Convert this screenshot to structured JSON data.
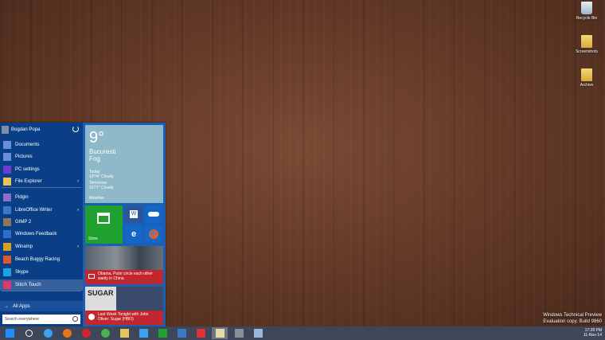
{
  "desktop": {
    "icons": [
      {
        "label": "Recycle Bin",
        "icon": "recycle-bin-icon"
      },
      {
        "label": "Screenshots",
        "icon": "folder-icon"
      },
      {
        "label": "Archive",
        "icon": "folder-icon"
      }
    ],
    "watermark": {
      "line1": "Windows Technical Preview",
      "line2": "Evaluation copy. Build 9860"
    }
  },
  "start_menu": {
    "user_name": "Bogdan Popa",
    "items": [
      {
        "label": "Documents",
        "icon": "documents-icon",
        "color": "#6b8fd6",
        "has_arrow": false
      },
      {
        "label": "Pictures",
        "icon": "pictures-icon",
        "color": "#6b8fd6",
        "has_arrow": false
      },
      {
        "label": "PC settings",
        "icon": "gear-icon",
        "color": "#6a3fd0",
        "has_arrow": false
      },
      {
        "label": "File Explorer",
        "icon": "folder-icon",
        "color": "#e8c25a",
        "has_arrow": true
      },
      {
        "label": "Pidgin",
        "icon": "pidgin-icon",
        "color": "#8a6fc6",
        "has_arrow": false
      },
      {
        "label": "LibreOffice Writer",
        "icon": "writer-icon",
        "color": "#3a78c8",
        "has_arrow": true
      },
      {
        "label": "GIMP 2",
        "icon": "gimp-icon",
        "color": "#8a7a5a",
        "has_arrow": false
      },
      {
        "label": "Windows Feedback",
        "icon": "feedback-icon",
        "color": "#2d6ecf",
        "has_arrow": false
      },
      {
        "label": "Winamp",
        "icon": "winamp-icon",
        "color": "#d4a020",
        "has_arrow": true
      },
      {
        "label": "Beach Buggy Racing",
        "icon": "game-icon",
        "color": "#d85a2a",
        "has_arrow": false
      },
      {
        "label": "Skype",
        "icon": "skype-icon",
        "color": "#1aa3e0",
        "has_arrow": false
      },
      {
        "label": "Stitch Touch",
        "icon": "heart-icon",
        "color": "#e0386a",
        "has_arrow": false
      }
    ],
    "all_apps": "All Apps",
    "search_placeholder": "Search everywhere",
    "tiles": {
      "weather": {
        "temp": "9°",
        "city": "Bucuresti",
        "condition": "Fog",
        "today": "Today",
        "today_fc": "10°/4° Cloudy",
        "tomorrow": "Tomorrow",
        "tomorrow_fc": "10°/7° Cloudy",
        "label": "Weather"
      },
      "store": {
        "label": "Store"
      },
      "news1": {
        "caption": "Obama, Putin circle each other warily in China"
      },
      "news2": {
        "banner": "SUGAR",
        "caption": "Last Week Tonight with John Oliver: Sugar (HBO)"
      }
    }
  },
  "taskbar": {
    "apps": [
      "start-icon",
      "search-icon",
      "ie-icon",
      "firefox-icon",
      "opera-icon",
      "chrome-icon",
      "explorer-icon",
      "twitter-icon",
      "store-icon",
      "game-icon",
      "plane-icon",
      "paint-icon",
      "mail-icon",
      "notepad-icon"
    ],
    "time": "17:28 PM",
    "date": "11-Nov-14"
  },
  "colors": {
    "accent": "#1a5fb4",
    "menu_left": "#0a3f87",
    "taskbar": "#3e4659",
    "news_red": "#c2272d"
  }
}
